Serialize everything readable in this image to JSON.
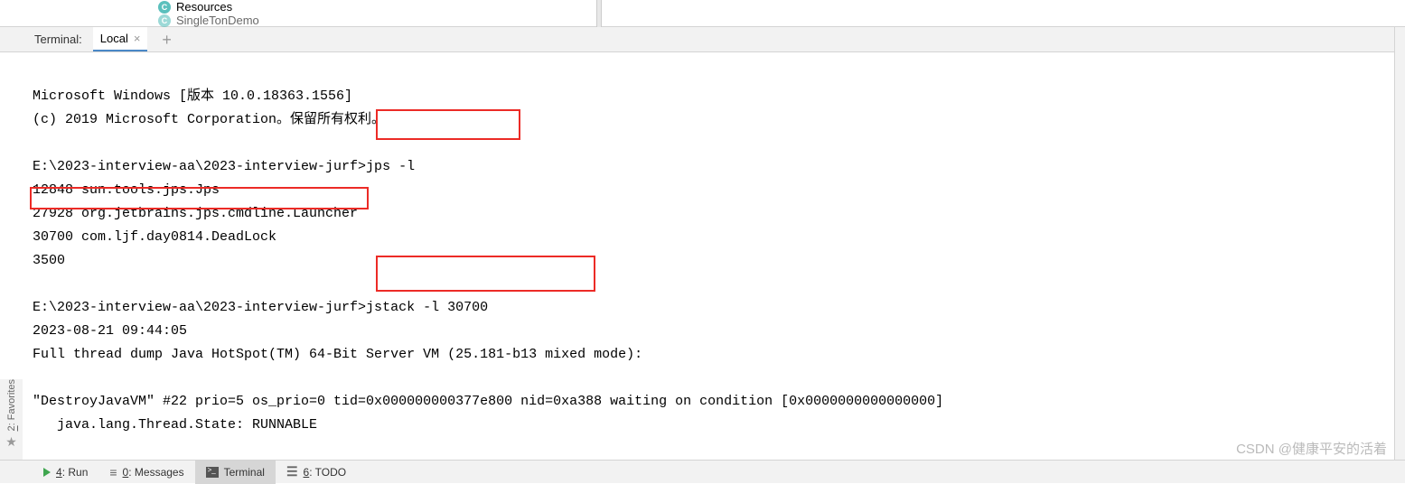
{
  "tree": {
    "item1": {
      "letter": "C",
      "label": "Resources"
    },
    "item2": {
      "letter": "C",
      "label": "SingleTonDemo"
    }
  },
  "terminal": {
    "panel_label": "Terminal:",
    "tab_name": "Local"
  },
  "console": {
    "line1": "Microsoft Windows [版本 10.0.18363.1556]",
    "line2": "(c) 2019 Microsoft Corporation。保留所有权利。",
    "line3": "",
    "line4": "E:\\2023-interview-aa\\2023-interview-jurf>jps -l",
    "line5": "12848 sun.tools.jps.Jps",
    "line6": "27928 org.jetbrains.jps.cmdline.Launcher",
    "line7": "30700 com.ljf.day0814.DeadLock",
    "line8": "3500",
    "line9": "",
    "line10": "E:\\2023-interview-aa\\2023-interview-jurf>jstack -l 30700",
    "line11": "2023-08-21 09:44:05",
    "line12": "Full thread dump Java HotSpot(TM) 64-Bit Server VM (25.181-b13 mixed mode):",
    "line13": "",
    "line14": "\"DestroyJavaVM\" #22 prio=5 os_prio=0 tid=0x000000000377e800 nid=0xa388 waiting on condition [0x0000000000000000]",
    "line15": "   java.lang.Thread.State: RUNNABLE"
  },
  "sidebar": {
    "favorites_key": "2",
    "favorites_label": ": Favorites"
  },
  "bottom": {
    "run_key": "4",
    "run_label": ": Run",
    "messages_key": "0",
    "messages_label": ": Messages",
    "terminal_label": "Terminal",
    "todo_key": "6",
    "todo_label": ": TODO"
  },
  "watermark": "CSDN @健康平安的活着"
}
